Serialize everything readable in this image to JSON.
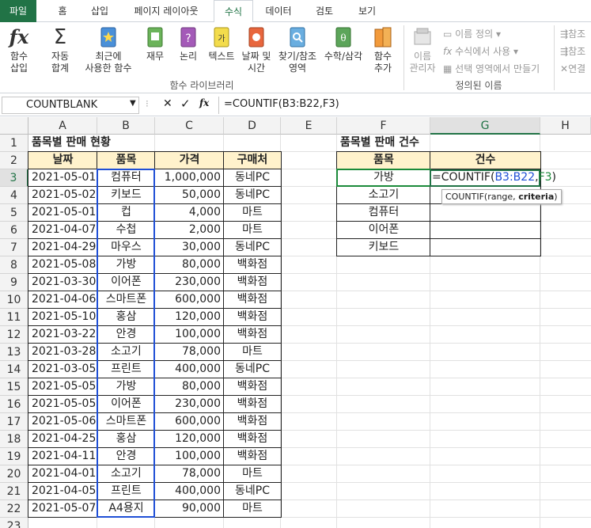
{
  "ribbon_tabs": [
    "파일",
    "홈",
    "삽입",
    "페이지 레이아웃",
    "수식",
    "데이터",
    "검토",
    "보기"
  ],
  "active_tab": "수식",
  "ribbon": {
    "insert_function": "함수\n삽입",
    "autosum": "자동\n합계",
    "recent": "최근에\n사용한 함수",
    "financial": "재무",
    "logical": "논리",
    "text": "텍스트",
    "datetime": "날짜 및\n시간",
    "lookup": "찾기/참조\n영역",
    "math": "수학/삼각",
    "more": "함수\n추가",
    "library_label": "함수 라이브러리",
    "name_manager": "이름\n관리자",
    "define_name": "이름 정의",
    "use_in_formula": "수식에서 사용",
    "create_from_selection": "선택 영역에서 만들기",
    "defined_names_label": "정의된 이름",
    "trace1": "참조",
    "trace2": "참조",
    "trace3": "연결"
  },
  "name_box": "COUNTBLANK",
  "formula": "=COUNTIF(B3:B22,F3)",
  "columns": [
    "A",
    "B",
    "C",
    "D",
    "E",
    "F",
    "G",
    "H"
  ],
  "rows": [
    "1",
    "2",
    "3",
    "4",
    "5",
    "6",
    "7",
    "8",
    "9",
    "10",
    "11",
    "12",
    "13",
    "14",
    "15",
    "16",
    "17",
    "18",
    "19",
    "20",
    "21",
    "22",
    "23"
  ],
  "left_title": "품목별 판매 현황",
  "left_headers": [
    "날짜",
    "품목",
    "가격",
    "구매처"
  ],
  "left_rows": [
    [
      "2021-05-01",
      "컴퓨터",
      "1,000,000",
      "동네PC"
    ],
    [
      "2021-05-02",
      "키보드",
      "50,000",
      "동네PC"
    ],
    [
      "2021-05-01",
      "컵",
      "4,000",
      "마트"
    ],
    [
      "2021-04-07",
      "수첩",
      "2,000",
      "마트"
    ],
    [
      "2021-04-29",
      "마우스",
      "30,000",
      "동네PC"
    ],
    [
      "2021-05-08",
      "가방",
      "80,000",
      "백화점"
    ],
    [
      "2021-03-30",
      "이어폰",
      "230,000",
      "백화점"
    ],
    [
      "2021-04-06",
      "스마트폰",
      "600,000",
      "백화점"
    ],
    [
      "2021-05-10",
      "홍삼",
      "120,000",
      "백화점"
    ],
    [
      "2021-03-22",
      "안경",
      "100,000",
      "백화점"
    ],
    [
      "2021-03-28",
      "소고기",
      "78,000",
      "마트"
    ],
    [
      "2021-03-05",
      "프린트",
      "400,000",
      "동네PC"
    ],
    [
      "2021-05-05",
      "가방",
      "80,000",
      "백화점"
    ],
    [
      "2021-05-05",
      "이어폰",
      "230,000",
      "백화점"
    ],
    [
      "2021-05-06",
      "스마트폰",
      "600,000",
      "백화점"
    ],
    [
      "2021-04-25",
      "홍삼",
      "120,000",
      "백화점"
    ],
    [
      "2021-04-11",
      "안경",
      "100,000",
      "백화점"
    ],
    [
      "2021-04-01",
      "소고기",
      "78,000",
      "마트"
    ],
    [
      "2021-04-05",
      "프린트",
      "400,000",
      "동네PC"
    ],
    [
      "2021-05-07",
      "A4용지",
      "90,000",
      "마트"
    ]
  ],
  "right_title": "품목별 판매 건수",
  "right_headers": [
    "품목",
    "건수"
  ],
  "right_items": [
    "가방",
    "소고기",
    "컴퓨터",
    "이어폰",
    "키보드"
  ],
  "edit_formula": {
    "p1": "=COUNTIF(",
    "p2": "B3:B22",
    "p3": ",",
    "p4": "F3",
    "p5": ")"
  },
  "tooltip": {
    "prefix": "COUNTIF(range, ",
    "bold": "criteria",
    "suffix": ")"
  },
  "colors": {
    "file_tab": "#217346",
    "header_fill": "#fff2cc",
    "range_blue": "#1f4fd6",
    "ref_green": "#1b8a3a"
  }
}
